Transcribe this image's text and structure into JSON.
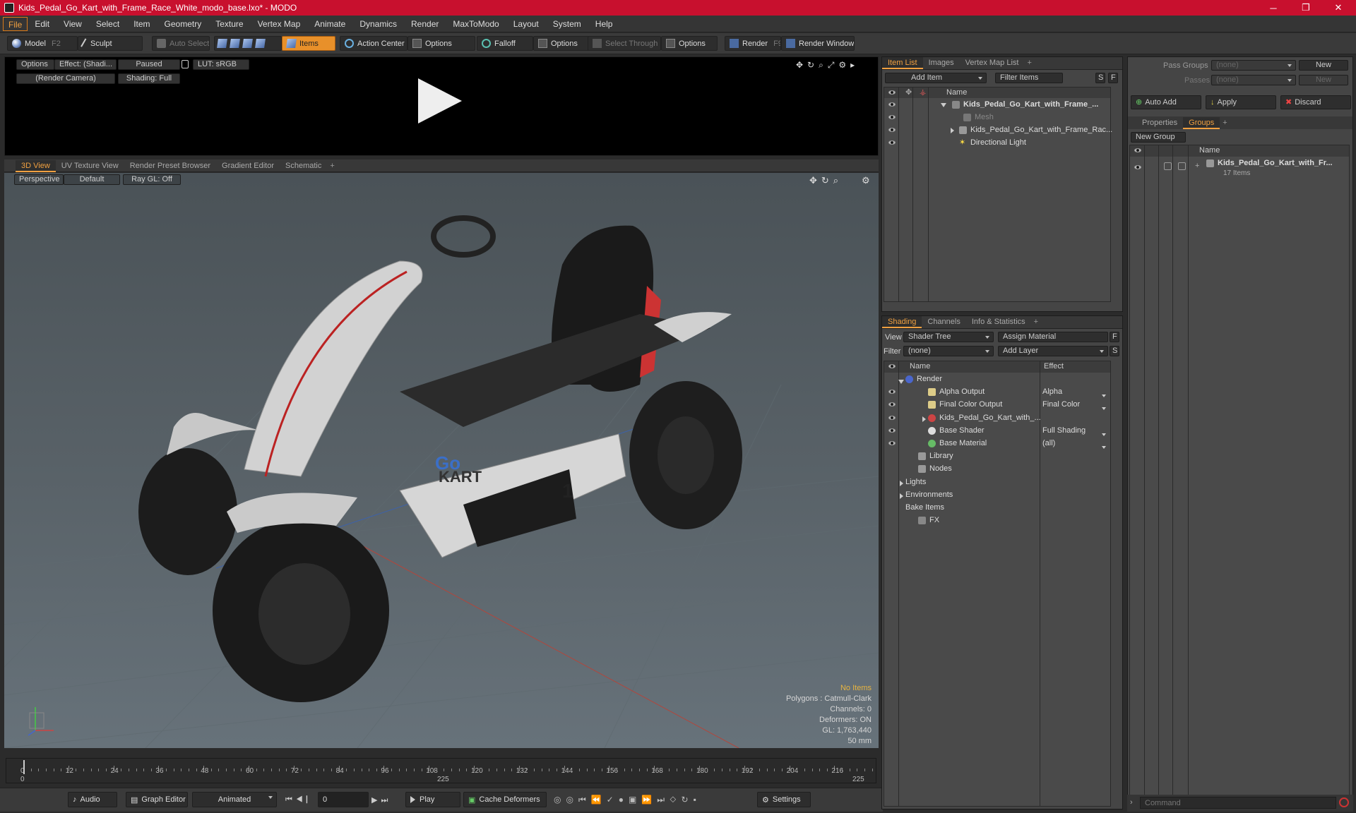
{
  "window": {
    "title": "Kids_Pedal_Go_Kart_with_Frame_Race_White_modo_base.lxo* - MODO",
    "minimize": "─",
    "maximize": "❐",
    "close": "✕"
  },
  "menu": [
    "File",
    "Edit",
    "View",
    "Select",
    "Item",
    "Geometry",
    "Texture",
    "Vertex Map",
    "Animate",
    "Dynamics",
    "Render",
    "MaxToModo",
    "Layout",
    "System",
    "Help"
  ],
  "toolbar": {
    "model": "Model",
    "model_key": "F2",
    "sculpt": "Sculpt",
    "auto_select": "Auto Select",
    "items": "Items",
    "action_center": "Action Center",
    "options1": "Options",
    "falloff": "Falloff",
    "options2": "Options",
    "select_through": "Select Through",
    "options3": "Options",
    "render": "Render",
    "render_key": "F9",
    "render_window": "Render Window"
  },
  "preview": {
    "options": "Options",
    "effect": "Effect: (Shadi...",
    "paused": "Paused",
    "lut": "LUT: sRGB",
    "camera": "(Render Camera)",
    "shading": "Shading: Full"
  },
  "viewport_tabs": {
    "tabs": [
      "3D View",
      "UV Texture View",
      "Render Preset Browser",
      "Gradient Editor",
      "Schematic"
    ],
    "plus": "+"
  },
  "viewport": {
    "perspective": "Perspective",
    "default": "Default",
    "raygl": "Ray GL: Off",
    "info": {
      "no_items": "No Items",
      "polygons": "Polygons : Catmull-Clark",
      "channels": "Channels: 0",
      "deformers": "Deformers: ON",
      "gl": "GL: 1,763,440",
      "size": "50 mm"
    },
    "kart_logo_go": "Go",
    "kart_logo_kart": "KART",
    "kart_number": "1"
  },
  "timeline": {
    "ticks": [
      "0",
      "12",
      "24",
      "36",
      "48",
      "60",
      "72",
      "84",
      "96",
      "108",
      "120",
      "132",
      "144",
      "156",
      "168",
      "180",
      "192",
      "204",
      "216"
    ],
    "start": "0",
    "mid": "225",
    "end": "225"
  },
  "bottom": {
    "audio": "Audio",
    "graph_editor": "Graph Editor",
    "animated": "Animated",
    "frame": "0",
    "play": "Play",
    "cache": "Cache Deformers",
    "settings": "Settings"
  },
  "item_list": {
    "tabs": [
      "Item List",
      "Images",
      "Vertex Map List"
    ],
    "plus": "+",
    "add_item": "Add Item",
    "filter": "Filter Items",
    "s": "S",
    "f": "F",
    "col_name": "Name",
    "rows": [
      "Kids_Pedal_Go_Kart_with_Frame_...",
      "Mesh",
      "Kids_Pedal_Go_Kart_with_Frame_Rac...",
      "Directional Light"
    ]
  },
  "shading": {
    "tabs": [
      "Shading",
      "Channels",
      "Info & Statistics"
    ],
    "plus": "+",
    "view_label": "View",
    "view_value": "Shader Tree",
    "assign": "Assign Material",
    "f": "F",
    "filter_label": "Filter",
    "filter_value": "(none)",
    "add_layer": "Add Layer",
    "s": "S",
    "col_name": "Name",
    "col_effect": "Effect",
    "rows": [
      {
        "name": "Render",
        "effect": ""
      },
      {
        "name": "Alpha Output",
        "effect": "Alpha"
      },
      {
        "name": "Final Color Output",
        "effect": "Final Color"
      },
      {
        "name": "Kids_Pedal_Go_Kart_with_...",
        "effect": ""
      },
      {
        "name": "Base Shader",
        "effect": "Full Shading"
      },
      {
        "name": "Base Material",
        "effect": "(all)"
      },
      {
        "name": "Library",
        "effect": ""
      },
      {
        "name": "Nodes",
        "effect": ""
      },
      {
        "name": "Lights",
        "effect": ""
      },
      {
        "name": "Environments",
        "effect": ""
      },
      {
        "name": "Bake Items",
        "effect": ""
      },
      {
        "name": "FX",
        "effect": ""
      }
    ]
  },
  "groups": {
    "pass_groups": "Pass Groups",
    "pass_value": "(none)",
    "new": "New",
    "passes": "Passes",
    "passes_value": "(none)",
    "new2": "New",
    "auto_add": "Auto Add",
    "apply": "Apply",
    "discard": "Discard",
    "tabs": [
      "Properties",
      "Groups"
    ],
    "plus": "+",
    "new_group": "New Group",
    "col_name": "Name",
    "item_name": "Kids_Pedal_Go_Kart_with_Fr...",
    "item_count": "17 Items"
  },
  "command": {
    "placeholder": "Command"
  }
}
